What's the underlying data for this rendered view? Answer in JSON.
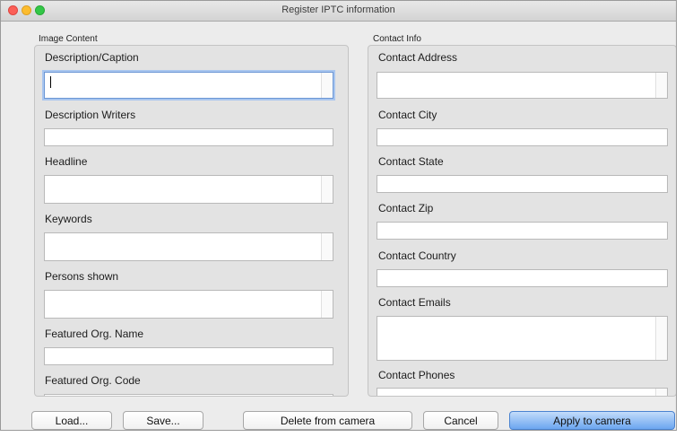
{
  "window": {
    "title": "Register IPTC information"
  },
  "image_content": {
    "group_label": "Image Content",
    "fields": [
      {
        "label": "Description/Caption",
        "value": ""
      },
      {
        "label": "Description Writers",
        "value": ""
      },
      {
        "label": "Headline",
        "value": ""
      },
      {
        "label": "Keywords",
        "value": ""
      },
      {
        "label": "Persons shown",
        "value": ""
      },
      {
        "label": "Featured Org. Name",
        "value": ""
      },
      {
        "label": "Featured Org. Code",
        "value": ""
      }
    ]
  },
  "contact_info": {
    "group_label": "Contact Info",
    "fields": [
      {
        "label": "Contact Address",
        "value": ""
      },
      {
        "label": "Contact City",
        "value": ""
      },
      {
        "label": "Contact State",
        "value": ""
      },
      {
        "label": "Contact Zip",
        "value": ""
      },
      {
        "label": "Contact Country",
        "value": ""
      },
      {
        "label": "Contact Emails",
        "value": ""
      },
      {
        "label": "Contact Phones",
        "value": ""
      }
    ]
  },
  "buttons": {
    "load": "Load...",
    "save": "Save...",
    "delete": "Delete from camera",
    "cancel": "Cancel",
    "apply": "Apply to camera"
  }
}
